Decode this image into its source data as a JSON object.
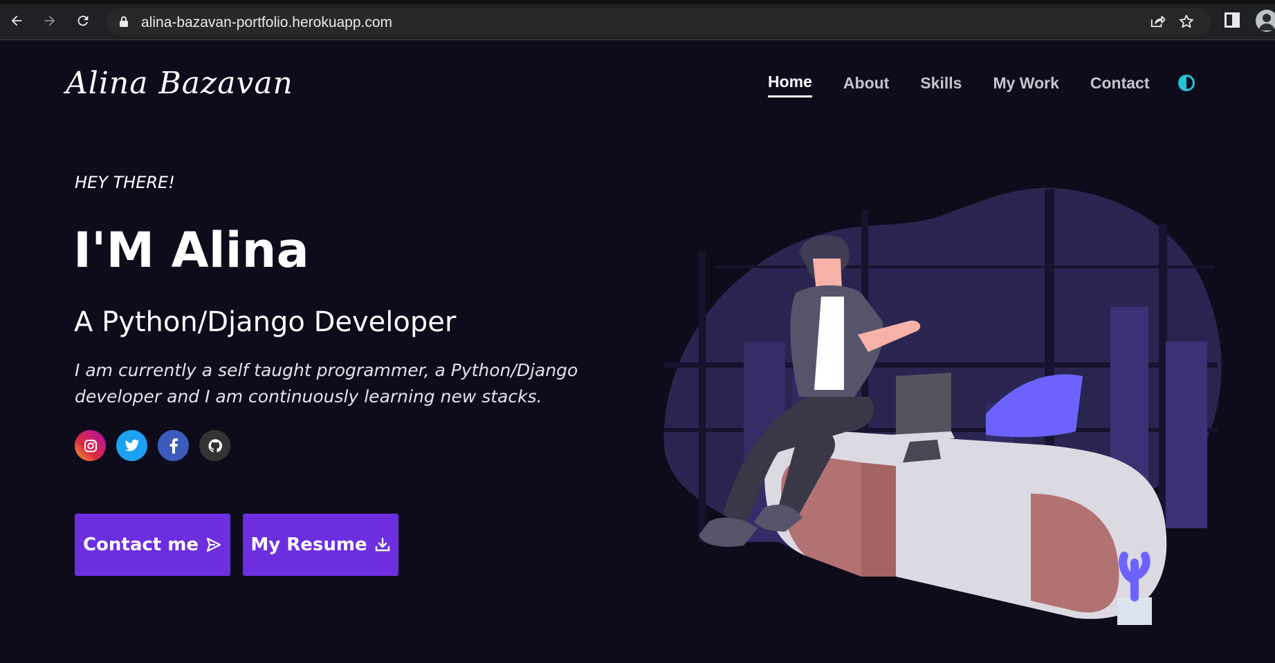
{
  "browser": {
    "url": "alina-bazavan-portfolio.herokuapp.com"
  },
  "site": {
    "logo": "Alina Bazavan",
    "nav": [
      {
        "label": "Home",
        "active": true
      },
      {
        "label": "About",
        "active": false
      },
      {
        "label": "Skills",
        "active": false
      },
      {
        "label": "My Work",
        "active": false
      },
      {
        "label": "Contact",
        "active": false
      }
    ],
    "theme_toggle_icon": "half-circle-icon"
  },
  "hero": {
    "greeting": "HEY THERE!",
    "title": "I'M Alina",
    "role": "A Python/Django Developer",
    "bio": "I am currently a self taught programmer, a Python/Django developer and I am continuously learning new stacks.",
    "socials": [
      {
        "name": "instagram",
        "icon": "instagram-icon"
      },
      {
        "name": "twitter",
        "icon": "twitter-icon"
      },
      {
        "name": "facebook",
        "icon": "facebook-icon"
      },
      {
        "name": "github",
        "icon": "github-icon"
      }
    ],
    "buttons": {
      "contact": "Contact me",
      "resume": "My Resume"
    }
  },
  "colors": {
    "background": "#0e0c1b",
    "accent": "#6d2ee0",
    "toggle": "#24c3d6"
  }
}
